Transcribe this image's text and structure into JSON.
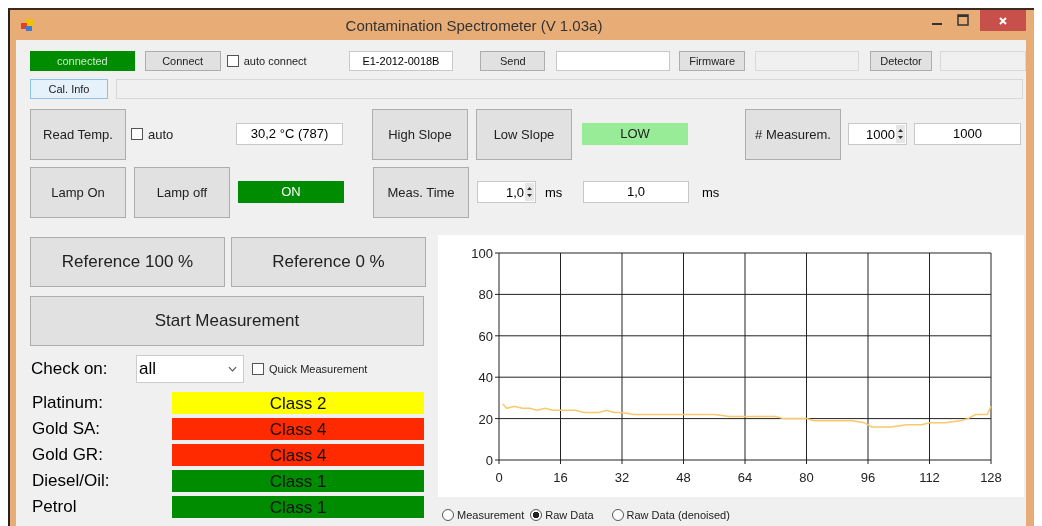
{
  "window": {
    "title": "Contamination Spectrometer (V 1.03a)"
  },
  "connection": {
    "status": "connected",
    "connect_button": "Connect",
    "auto_connect": {
      "label": "auto connect",
      "checked": false
    },
    "serial": "E1-2012-0018B",
    "send_button": "Send",
    "firmware_button": "Firmware",
    "detector_button": "Detector"
  },
  "cal_info": {
    "label": "Cal. Info",
    "focused": true
  },
  "temperature": {
    "button": "Read Temp.",
    "auto": {
      "label": "auto",
      "checked": false
    },
    "value": "30,2 °C (787)"
  },
  "lamp": {
    "on_button": "Lamp On",
    "off_button": "Lamp off",
    "state": "ON",
    "on": true
  },
  "slope": {
    "high_button": "High Slope",
    "low_button": "Low Slope",
    "state": "LOW"
  },
  "meas_time": {
    "button": "Meas. Time",
    "spinner": "1,0",
    "unit": "ms",
    "value": "1,0",
    "unit_2": "ms"
  },
  "measurements": {
    "button": "# Measurem.",
    "spinner": "1000",
    "value": "1000"
  },
  "reference_buttons": [
    "Reference 100 %",
    "Reference 0 %"
  ],
  "start_button": "Start Measurement",
  "check_on": {
    "label": "Check on:",
    "value": "all",
    "quick": {
      "label": "Quick Measurement",
      "checked": false
    }
  },
  "results": [
    {
      "label": "Platinum:",
      "value": "Class 2",
      "color": "#ffff00"
    },
    {
      "label": "Gold SA:",
      "value": "Class 4",
      "color": "#ff2a00"
    },
    {
      "label": "Gold GR:",
      "value": "Class 4",
      "color": "#ff2a00"
    },
    {
      "label": "Diesel/Oil:",
      "value": "Class 1",
      "color": "#008c00"
    },
    {
      "label": "Petrol",
      "value": "Class 1",
      "color": "#008c00"
    }
  ],
  "chart_data": {
    "type": "line",
    "x": [
      1,
      2,
      4,
      6,
      8,
      10,
      12,
      14,
      16,
      20,
      22,
      26,
      28,
      30,
      32,
      35,
      40,
      48,
      56,
      60,
      64,
      72,
      74,
      80,
      82,
      88,
      92,
      95,
      97,
      100,
      102,
      106,
      110,
      112,
      116,
      120,
      122,
      124,
      127,
      128
    ],
    "series": [
      {
        "color": "#f9c86c",
        "values": [
          27,
          25,
          26,
          25,
          25,
          24,
          25,
          24,
          24,
          24,
          23,
          23,
          24,
          23,
          23,
          22,
          22,
          22,
          22,
          21,
          21,
          21,
          20,
          20,
          19,
          19,
          19,
          18,
          16,
          16,
          16,
          17,
          17,
          18,
          18,
          19,
          20,
          22,
          22,
          26
        ]
      }
    ],
    "grid": true,
    "xlim": [
      0,
      128
    ],
    "ylim": [
      0,
      100
    ],
    "xticks": [
      0,
      16,
      32,
      48,
      64,
      80,
      96,
      112,
      128
    ],
    "yticks": [
      0,
      20,
      40,
      60,
      80,
      100
    ]
  },
  "view_options": [
    {
      "label": "Measurement",
      "selected": false
    },
    {
      "label": "Raw Data",
      "selected": true
    },
    {
      "label": "Raw Data (denoised)",
      "selected": false
    }
  ]
}
